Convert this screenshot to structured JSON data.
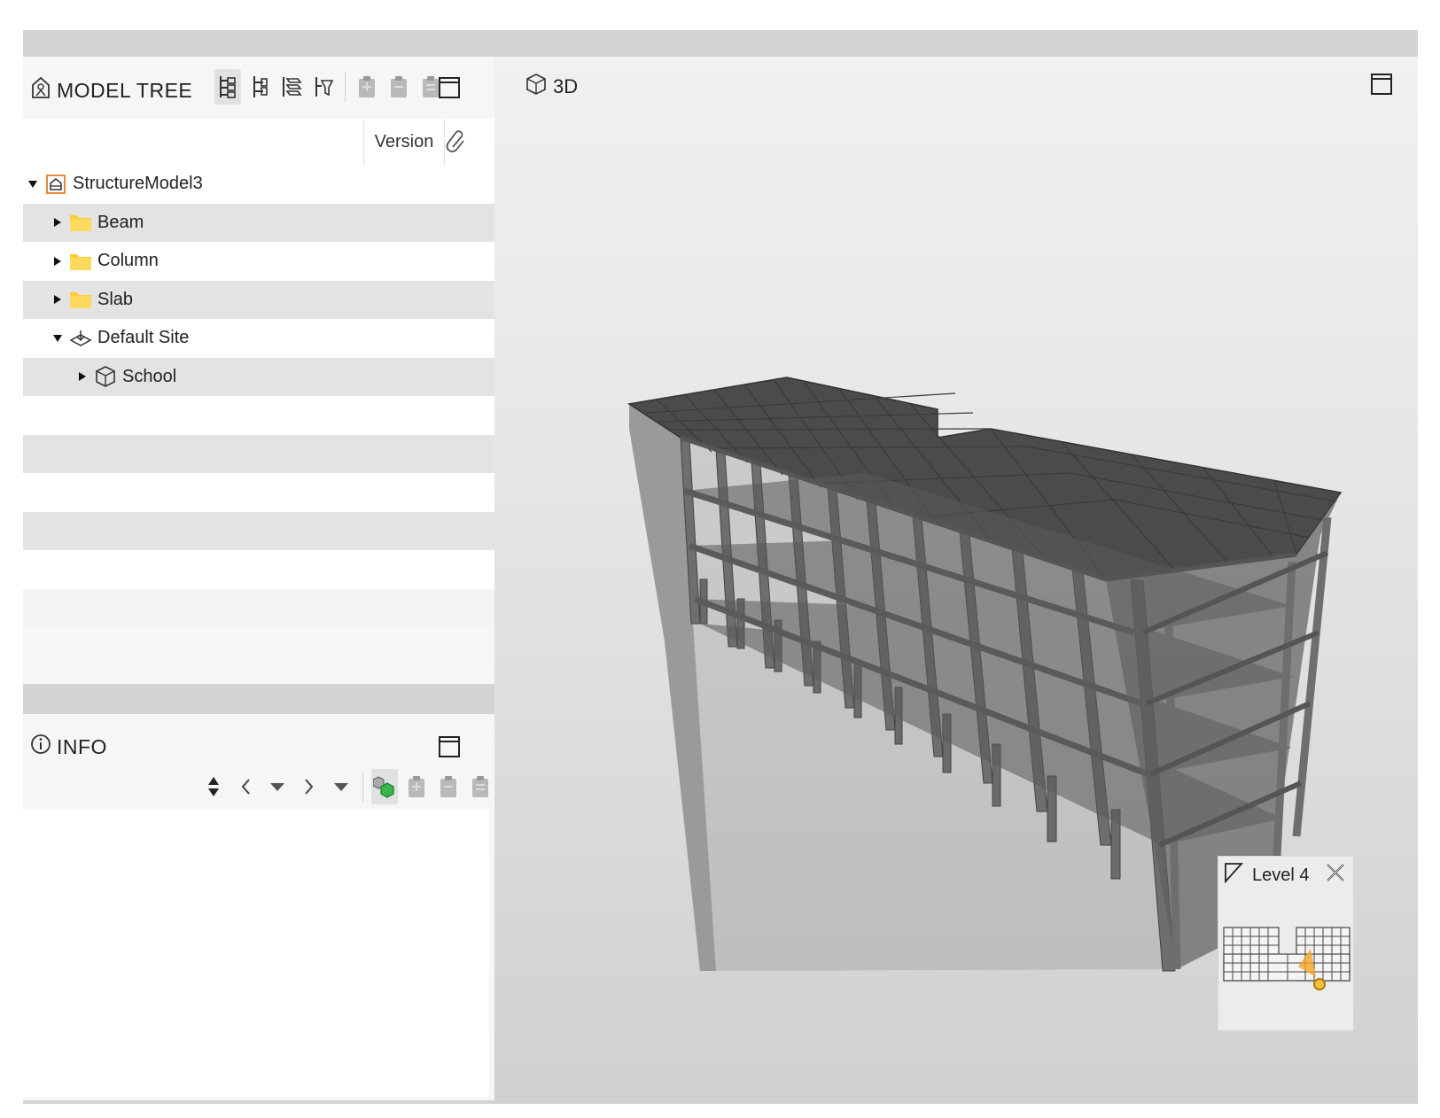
{
  "model_tree": {
    "title": "MODEL TREE",
    "columns": {
      "version": "Version"
    },
    "rows": [
      {
        "label": "StructureModel3",
        "icon": "project-icon",
        "expanded": true
      },
      {
        "label": "Beam",
        "icon": "folder-icon",
        "expanded": false
      },
      {
        "label": "Column",
        "icon": "folder-icon",
        "expanded": false
      },
      {
        "label": "Slab",
        "icon": "folder-icon",
        "expanded": false
      },
      {
        "label": "Default Site",
        "icon": "site-icon",
        "expanded": true
      },
      {
        "label": "School",
        "icon": "building-cube-icon",
        "expanded": false
      }
    ]
  },
  "info": {
    "title": "INFO"
  },
  "viewport": {
    "title": "3D",
    "level_navigator": {
      "label": "Level 4"
    }
  },
  "colors": {
    "panel_bg": "#f6f6f6",
    "row_alt": "#e3e3e3",
    "model_dark": "#4a4a4a",
    "folder_yellow": "#ffcc33",
    "accent_orange": "#f5a623",
    "accent_green": "#39b54a"
  }
}
